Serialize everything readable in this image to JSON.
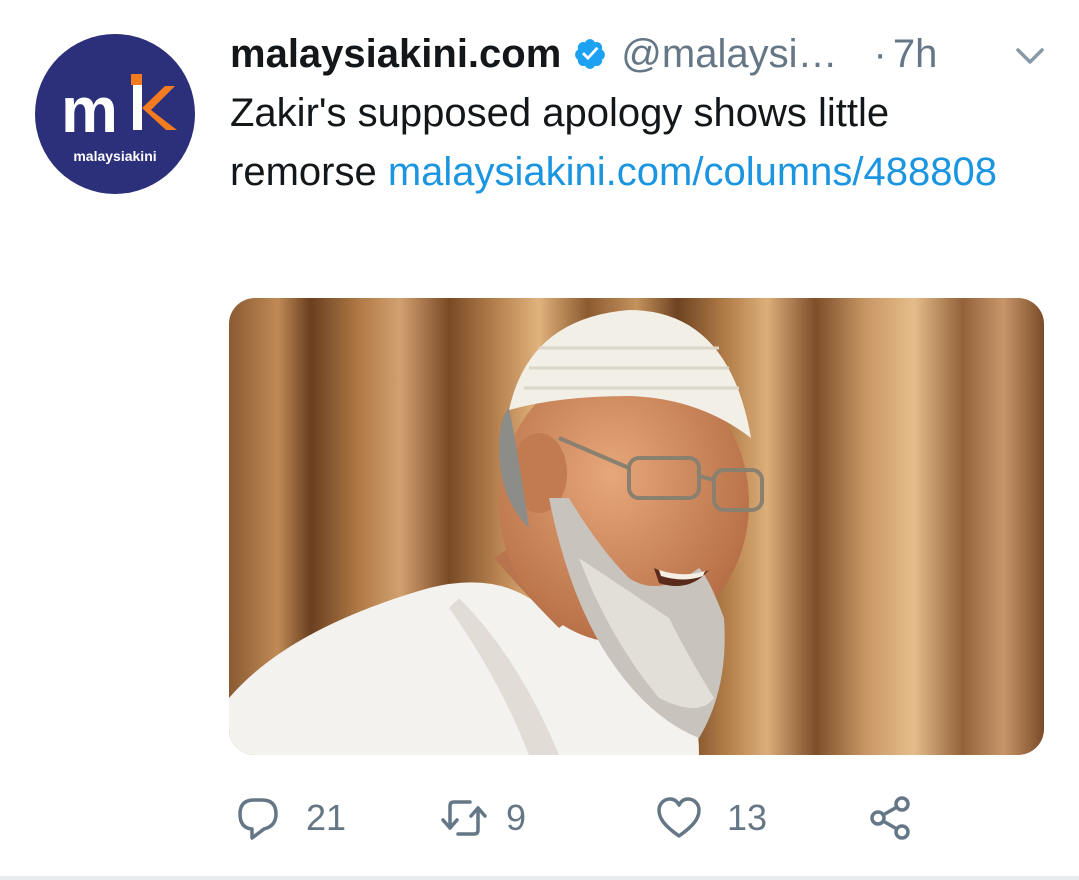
{
  "tweet": {
    "author": {
      "name": "malaysiakini.com",
      "handle": "@malaysi…",
      "verified": true,
      "avatar": {
        "logo_text": "malaysiakini",
        "bg_color": "#2c2f7a",
        "accent_color": "#f47c20"
      }
    },
    "separator": "·",
    "time": "7h",
    "text": "Zakir's supposed apology shows little remorse",
    "link": "malaysiakini.com/columns/488808",
    "media": {
      "kind": "photo"
    },
    "actions": {
      "reply_count": "21",
      "retweet_count": "9",
      "like_count": "13"
    },
    "icons": [
      "verified-badge-icon",
      "chevron-down-icon",
      "reply-icon",
      "retweet-icon",
      "like-icon",
      "share-icon"
    ]
  },
  "colors": {
    "text": "#14171a",
    "muted": "#657786",
    "link": "#1b95e0",
    "verified": "#1da1f2"
  }
}
